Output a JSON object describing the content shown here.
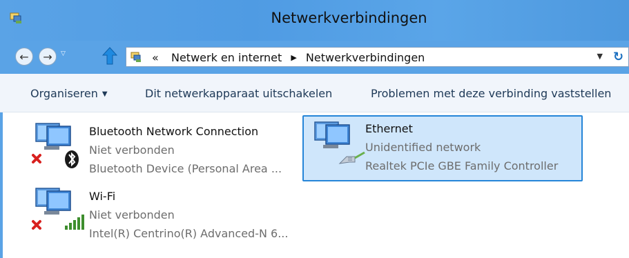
{
  "window": {
    "title": "Netwerkverbindingen"
  },
  "address": {
    "overflow": "«",
    "crumbs": [
      "Netwerk en internet",
      "Netwerkverbindingen"
    ],
    "separator": "▶"
  },
  "commands": {
    "organize": "Organiseren",
    "disable": "Dit netwerkapparaat uitschakelen",
    "diagnose": "Problemen met deze verbinding vaststellen"
  },
  "connections": [
    {
      "name": "Bluetooth Network Connection",
      "status": "Niet verbonden",
      "device": "Bluetooth Device (Personal Area ...",
      "icon": "bluetooth-network-icon"
    },
    {
      "name": "Wi-Fi",
      "status": "Niet verbonden",
      "device": "Intel(R) Centrino(R) Advanced-N 6...",
      "icon": "wifi-network-icon"
    },
    {
      "name": "Ethernet",
      "status": "Unidentified network",
      "device": "Realtek PCIe GBE Family Controller",
      "icon": "ethernet-network-icon",
      "selected": true
    }
  ],
  "colors": {
    "titlebar": "#5aa3e6",
    "selection_fill": "#cfe6fb",
    "selection_border": "#2585d8"
  }
}
